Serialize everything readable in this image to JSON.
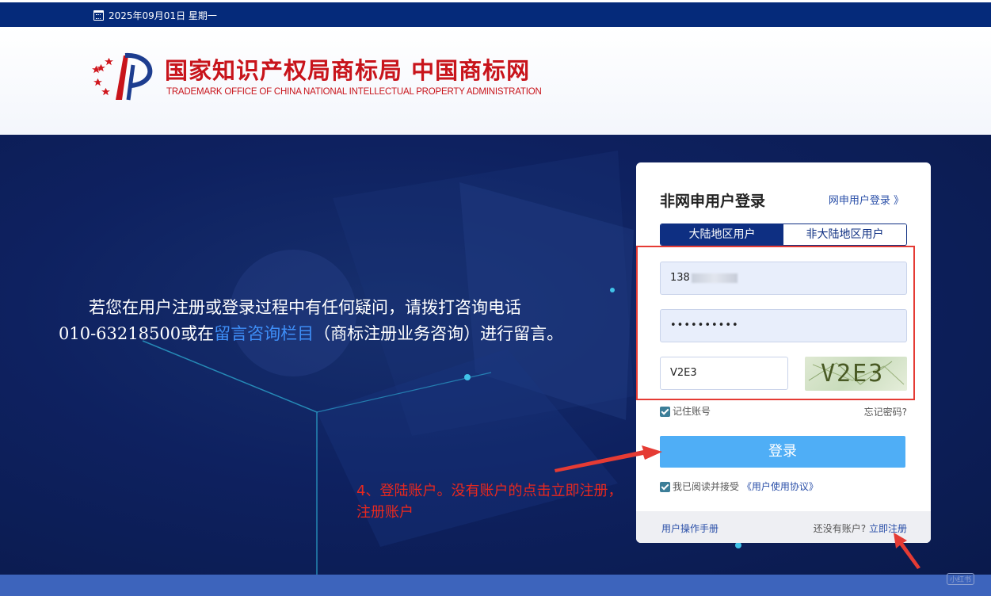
{
  "topbar": {
    "date": "2025年09月01日 星期一"
  },
  "header": {
    "title_cn": "国家知识产权局商标局 中国商标网",
    "title_en": "TRADEMARK OFFICE OF CHINA NATIONAL INTELLECTUAL PROPERTY ADMINISTRATION"
  },
  "notice": {
    "line1": "若您在用户注册或登录过程中有任何疑问，请拨打咨询电话",
    "line2_prefix": "010-63218500或在",
    "line2_link": "留言咨询栏目",
    "line2_suffix": "（商标注册业务咨询）进行留言。"
  },
  "login": {
    "title": "非网申用户登录",
    "switch_link": "网申用户登录 》",
    "tabs": [
      {
        "label": "大陆地区用户",
        "active": true
      },
      {
        "label": "非大陆地区用户",
        "active": false
      }
    ],
    "phone_value": "138",
    "password_value": "••••••••••",
    "captcha_value": "V2E3",
    "captcha_image_text": "V2E3",
    "remember_label": "记住账号",
    "remember_checked": true,
    "forgot_link": "忘记密码?",
    "submit_label": "登录",
    "agree_prefix": "我已阅读并接受",
    "agree_link": "《用户使用协议》",
    "agree_checked": true,
    "manual_link": "用户操作手册",
    "no_account_text": "还没有账户?",
    "register_link": "立即注册"
  },
  "annotation": {
    "text": "4、登陆账户。没有账户的点击立即注册，注册账户"
  },
  "watermark": "小红书",
  "colors": {
    "topbar": "#052a7a",
    "brand_red": "#c8141b",
    "tab_active": "#0e2f82",
    "button": "#4faef6",
    "annotation_red": "#e8281e"
  }
}
